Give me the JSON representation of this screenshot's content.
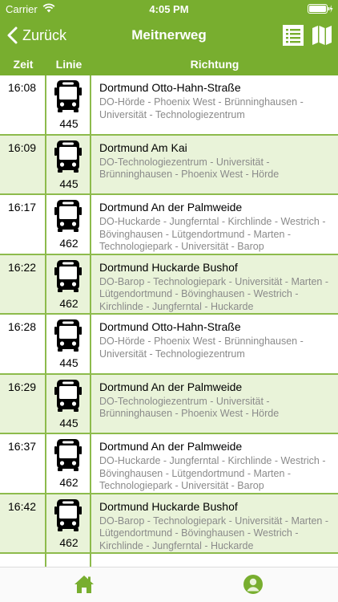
{
  "status_bar": {
    "carrier": "Carrier",
    "time": "4:05 PM"
  },
  "nav": {
    "back_label": "Zurück",
    "title": "Meitnerweg"
  },
  "columns": {
    "zeit": "Zeit",
    "linie": "Linie",
    "richtung": "Richtung"
  },
  "colors": {
    "brand_green": "#78ae2f",
    "row_alt": "#e9f3d9",
    "divider": "#8dbb4c",
    "secondary_text": "#8a8a8a"
  },
  "departures": [
    {
      "time": "16:08",
      "line": "445",
      "destination": "Dortmund Otto-Hahn-Straße",
      "via": "DO-Hörde - Phoenix West - Brünninghausen - Universität - Technologiezentrum"
    },
    {
      "time": "16:09",
      "line": "445",
      "destination": "Dortmund Am Kai",
      "via": "DO-Technologiezentrum - Universität - Brünninghausen - Phoenix West - Hörde"
    },
    {
      "time": "16:17",
      "line": "462",
      "destination": "Dortmund An der Palmweide",
      "via": "DO-Huckarde - Jungferntal - Kirchlinde - Westrich - Bövinghausen - Lütgendortmund - Marten - Technologiepark - Universität - Barop"
    },
    {
      "time": "16:22",
      "line": "462",
      "destination": "Dortmund Huckarde Bushof",
      "via": "DO-Barop - Technologiepark - Universität - Marten - Lütgendortmund - Bövinghausen - Westrich - Kirchlinde - Jungferntal - Huckarde"
    },
    {
      "time": "16:28",
      "line": "445",
      "destination": "Dortmund Otto-Hahn-Straße",
      "via": "DO-Hörde - Phoenix West - Brünninghausen - Universität - Technologiezentrum"
    },
    {
      "time": "16:29",
      "line": "445",
      "destination": "Dortmund An der Palmweide",
      "via": "DO-Technologiezentrum - Universität - Brünninghausen - Phoenix West - Hörde"
    },
    {
      "time": "16:37",
      "line": "462",
      "destination": "Dortmund An der Palmweide",
      "via": "DO-Huckarde - Jungferntal - Kirchlinde - Westrich - Bövinghausen - Lütgendortmund - Marten - Technologiepark - Universität - Barop"
    },
    {
      "time": "16:42",
      "line": "462",
      "destination": "Dortmund Huckarde Bushof",
      "via": "DO-Barop - Technologiepark - Universität - Marten - Lütgendortmund - Bövinghausen - Westrich - Kirchlinde - Jungferntal - Huckarde"
    }
  ],
  "tabs": [
    {
      "icon": "home-icon"
    },
    {
      "icon": "profile-icon"
    }
  ]
}
